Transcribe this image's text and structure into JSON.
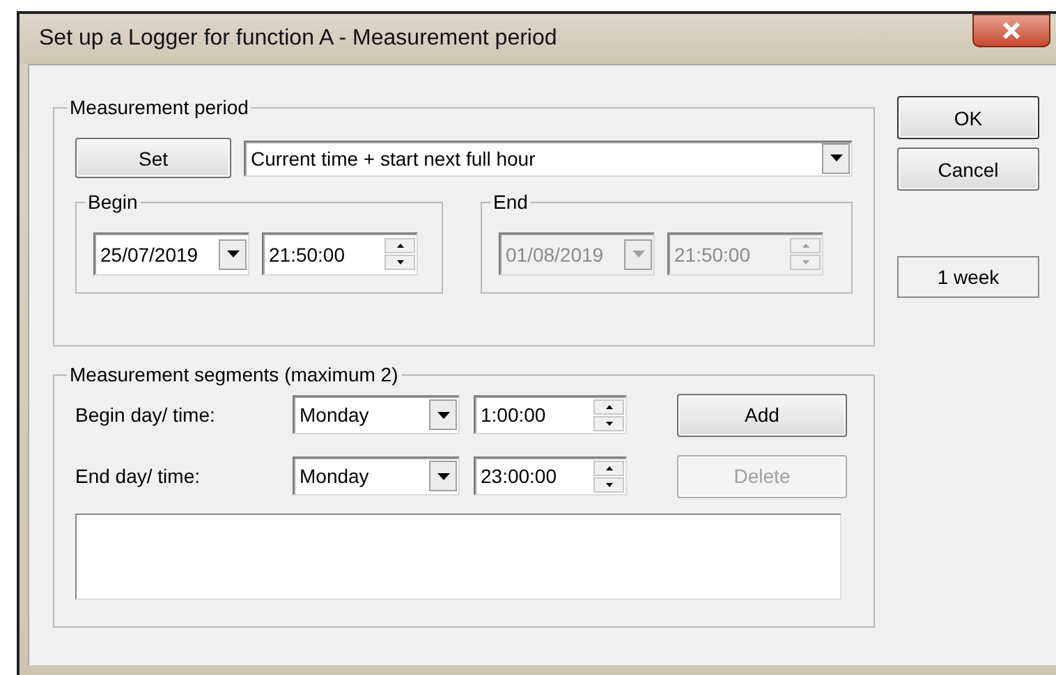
{
  "window": {
    "title": "Set up a Logger for function A - Measurement period"
  },
  "measurement_period": {
    "title": "Measurement period",
    "set_button": "Set",
    "mode": "Current time + start next full hour",
    "begin": {
      "title": "Begin",
      "date": "25/07/2019",
      "time": "21:50:00",
      "disabled": false
    },
    "end": {
      "title": "End",
      "date": "01/08/2019",
      "time": "21:50:00",
      "disabled": true
    }
  },
  "segments": {
    "title": "Measurement segments (maximum 2)",
    "rows": [
      {
        "label": "Begin day/ time:",
        "day": "Monday",
        "time": "1:00:00",
        "button": "Add",
        "button_disabled": false
      },
      {
        "label": "End day/ time:",
        "day": "Monday",
        "time": "23:00:00",
        "button": "Delete",
        "button_disabled": true
      }
    ]
  },
  "buttons": [
    {
      "label": "OK",
      "default": true
    },
    {
      "label": "Cancel",
      "default": false
    }
  ],
  "duration": "1 week"
}
